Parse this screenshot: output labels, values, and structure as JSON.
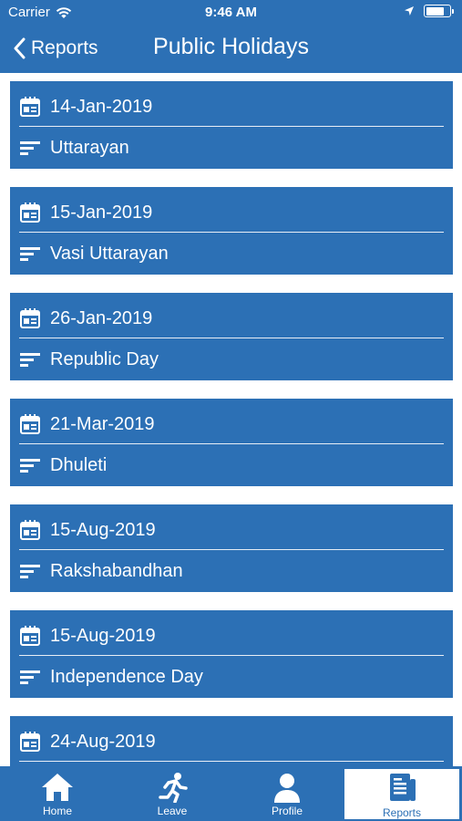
{
  "status": {
    "carrier": "Carrier",
    "time": "9:46 AM",
    "battery_level": 0.8
  },
  "nav": {
    "back_label": "Reports",
    "title": "Public Holidays"
  },
  "holidays": [
    {
      "date": "14-Jan-2019",
      "name": "Uttarayan"
    },
    {
      "date": "15-Jan-2019",
      "name": "Vasi Uttarayan"
    },
    {
      "date": "26-Jan-2019",
      "name": "Republic Day"
    },
    {
      "date": "21-Mar-2019",
      "name": "Dhuleti"
    },
    {
      "date": "15-Aug-2019",
      "name": "Rakshabandhan"
    },
    {
      "date": "15-Aug-2019",
      "name": "Independence Day"
    },
    {
      "date": "24-Aug-2019",
      "name": ""
    }
  ],
  "tabs": [
    {
      "label": "Home",
      "icon": "home-icon"
    },
    {
      "label": "Leave",
      "icon": "running-person-icon"
    },
    {
      "label": "Profile",
      "icon": "person-icon"
    },
    {
      "label": "Reports",
      "icon": "report-document-icon",
      "active": true
    }
  ],
  "colors": {
    "primary": "#2c70b5",
    "background": "#ffffff"
  }
}
